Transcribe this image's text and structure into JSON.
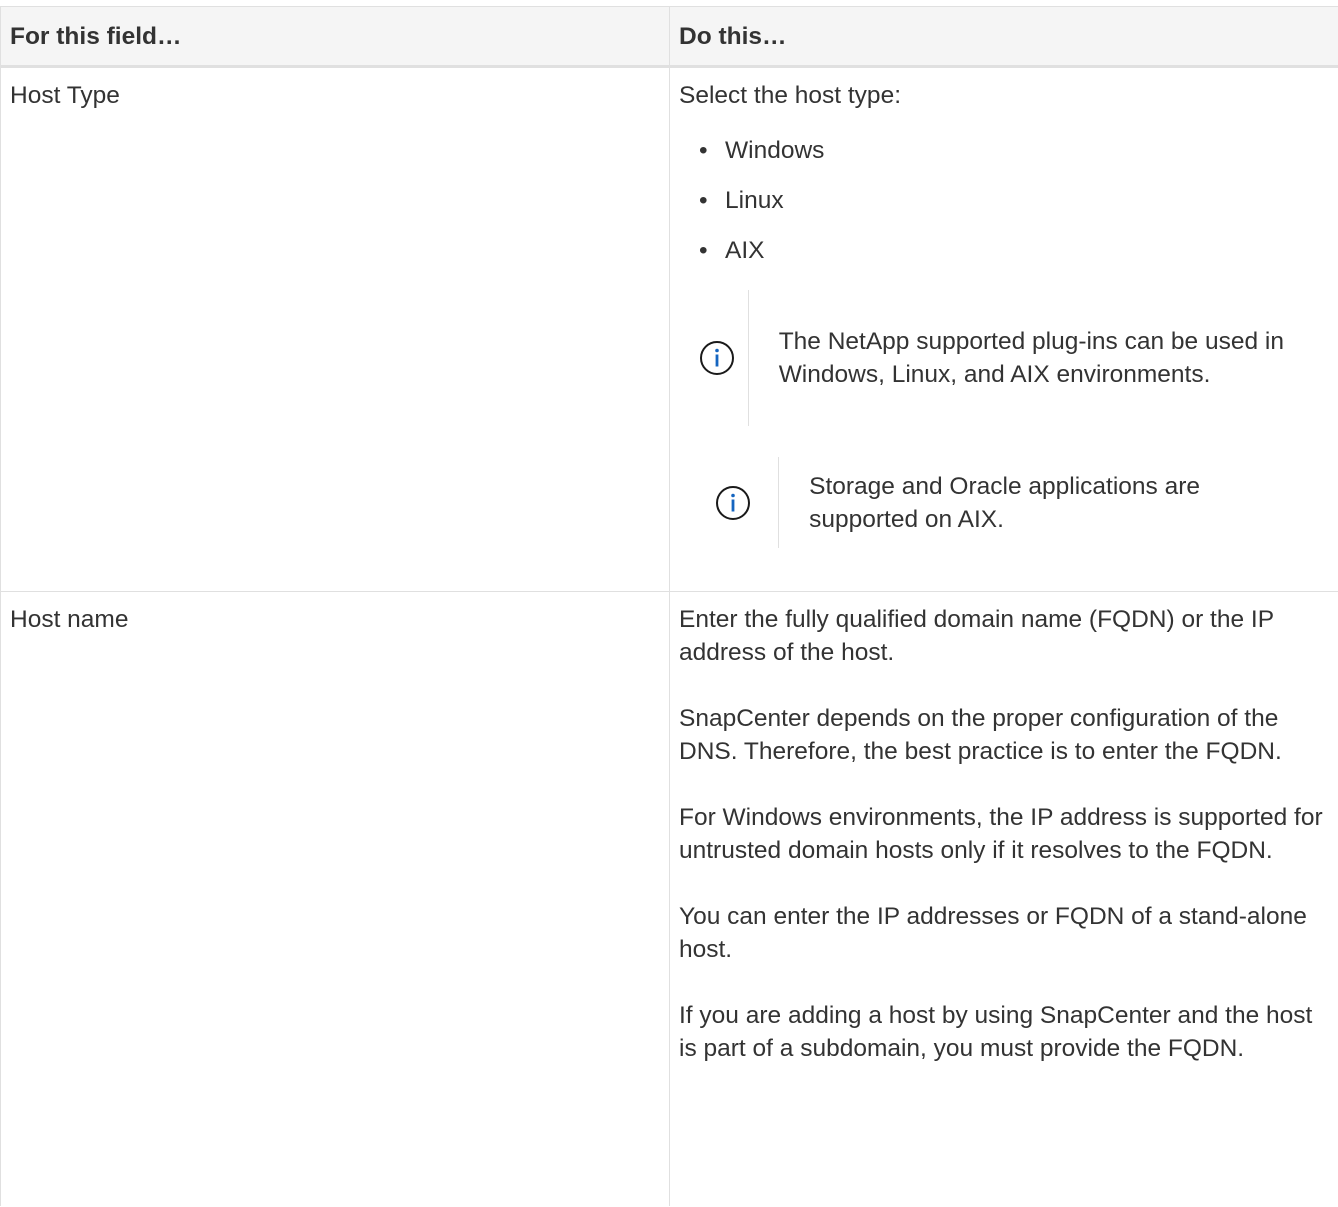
{
  "table": {
    "header": {
      "col1": "For this field…",
      "col2": "Do this…"
    },
    "rows": [
      {
        "field": "Host Type",
        "intro": "Select the host type:",
        "options": [
          "Windows",
          "Linux",
          "AIX"
        ],
        "notes": [
          {
            "icon": "info-icon",
            "text": "The NetApp supported plug-ins can be used in Windows, Linux, and AIX environments."
          },
          {
            "icon": "info-icon",
            "text": "Storage and Oracle applications are supported on AIX."
          }
        ]
      },
      {
        "field": "Host name",
        "paragraphs": [
          "Enter the fully qualified domain name (FQDN) or the IP address of the host.",
          "SnapCenter depends on the proper configuration of the DNS. Therefore, the best practice is to enter the FQDN.",
          "For Windows environments, the IP address is supported for untrusted domain hosts only if it resolves to the FQDN.",
          "You can enter the IP addresses or FQDN of a stand-alone host.",
          "If you are adding a host by using SnapCenter and the host is part of a subdomain, you must provide the FQDN."
        ]
      }
    ]
  },
  "colors": {
    "text": "#333333",
    "border": "#e0e0e0",
    "header_bg": "#f5f5f5",
    "info_icon": "#1565c0"
  }
}
